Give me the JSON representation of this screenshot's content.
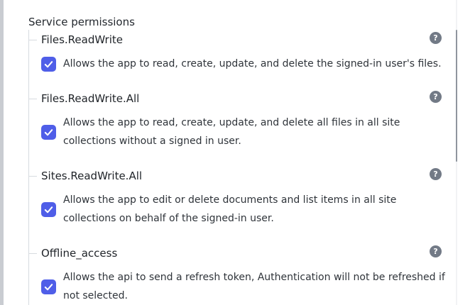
{
  "section": {
    "title": "Service permissions"
  },
  "permissions": [
    {
      "name": "Files.ReadWrite",
      "description": "Allows the app to read, create, update, and delete the signed-in user's files.",
      "checked": true,
      "help_icon": "question-circle-icon"
    },
    {
      "name": "Files.ReadWrite.All",
      "description": "Allows the app to read, create, update, and delete all files in all site collections without a signed in user.",
      "checked": true,
      "help_icon": "question-circle-icon"
    },
    {
      "name": "Sites.ReadWrite.All",
      "description": "Allows the app to edit or delete documents and list items in all site collections on behalf of the signed-in user.",
      "checked": true,
      "help_icon": "question-circle-icon"
    },
    {
      "name": "Offline_access",
      "description": "Allows the api to send a refresh token, Authentication will not be refreshed if not selected.",
      "checked": true,
      "help_icon": "question-circle-icon"
    }
  ],
  "colors": {
    "checkbox": "#4f5ee8",
    "help_icon": "#727a86"
  }
}
